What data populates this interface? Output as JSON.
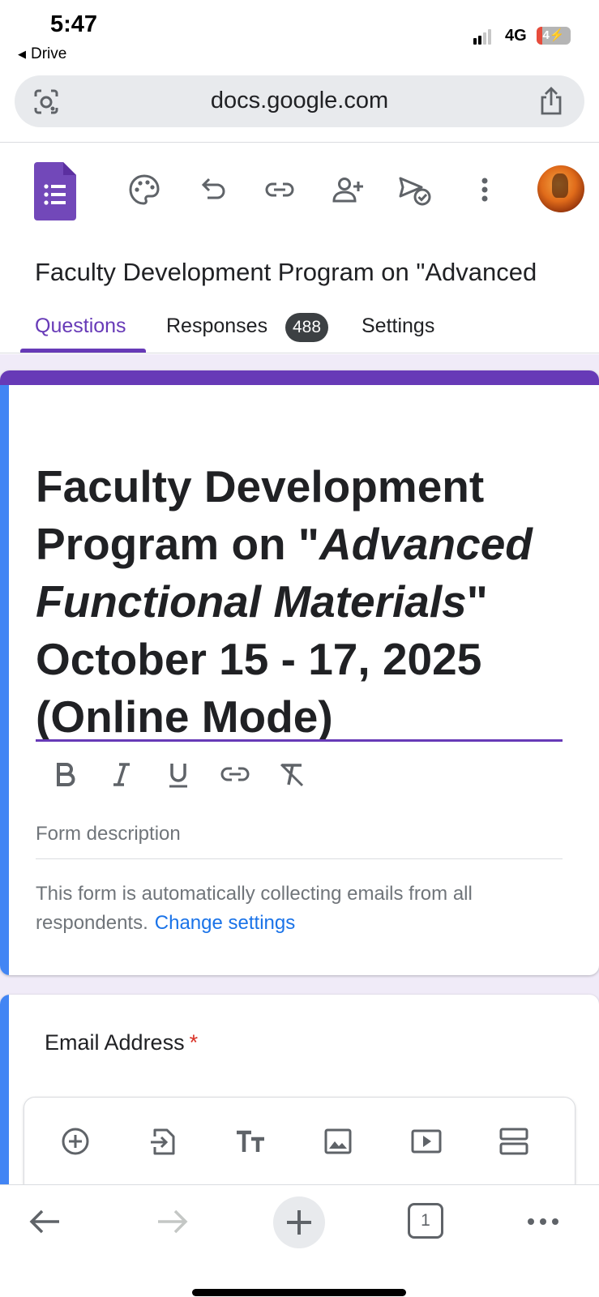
{
  "status": {
    "time": "5:47",
    "back_app": "Drive",
    "network": "4G",
    "battery": "4"
  },
  "browser": {
    "url": "docs.google.com",
    "tab_count": "1"
  },
  "document": {
    "title": "Faculty Development Program on \"Advanced"
  },
  "tabs": [
    {
      "label": "Questions",
      "active": true
    },
    {
      "label": "Responses",
      "badge": "488"
    },
    {
      "label": "Settings"
    }
  ],
  "form": {
    "title": {
      "line1": "Faculty Development",
      "line2_plain": "Program on \"",
      "line2_italic": "Advanced",
      "line3_italic": "Functional Materials",
      "line3_plain": "\"",
      "line4": "October 15 - 17, 2025",
      "line5": "(Online Mode)"
    },
    "description_placeholder": "Form description",
    "email_note": "This form is automatically collecting emails from all respondents.",
    "change_settings": "Change settings"
  },
  "question": {
    "label": "Email Address",
    "required_mark": "*"
  },
  "colors": {
    "accent": "#673ab7",
    "blue": "#4285f4",
    "background": "#f0ebf8",
    "link": "#1a73e8"
  },
  "icons": {
    "toolbar": [
      "palette-icon",
      "undo-icon",
      "link-icon",
      "add-collaborator-icon",
      "send-icon",
      "more-icon"
    ],
    "format": [
      "bold-icon",
      "italic-icon",
      "underline-icon",
      "link-icon",
      "clear-format-icon"
    ],
    "floatbar": [
      "add-question-icon",
      "import-questions-icon",
      "add-title-icon",
      "add-image-icon",
      "add-video-icon",
      "add-section-icon"
    ],
    "nav": [
      "back-icon",
      "forward-icon",
      "new-tab-icon",
      "tabs-icon",
      "more-icon"
    ]
  }
}
